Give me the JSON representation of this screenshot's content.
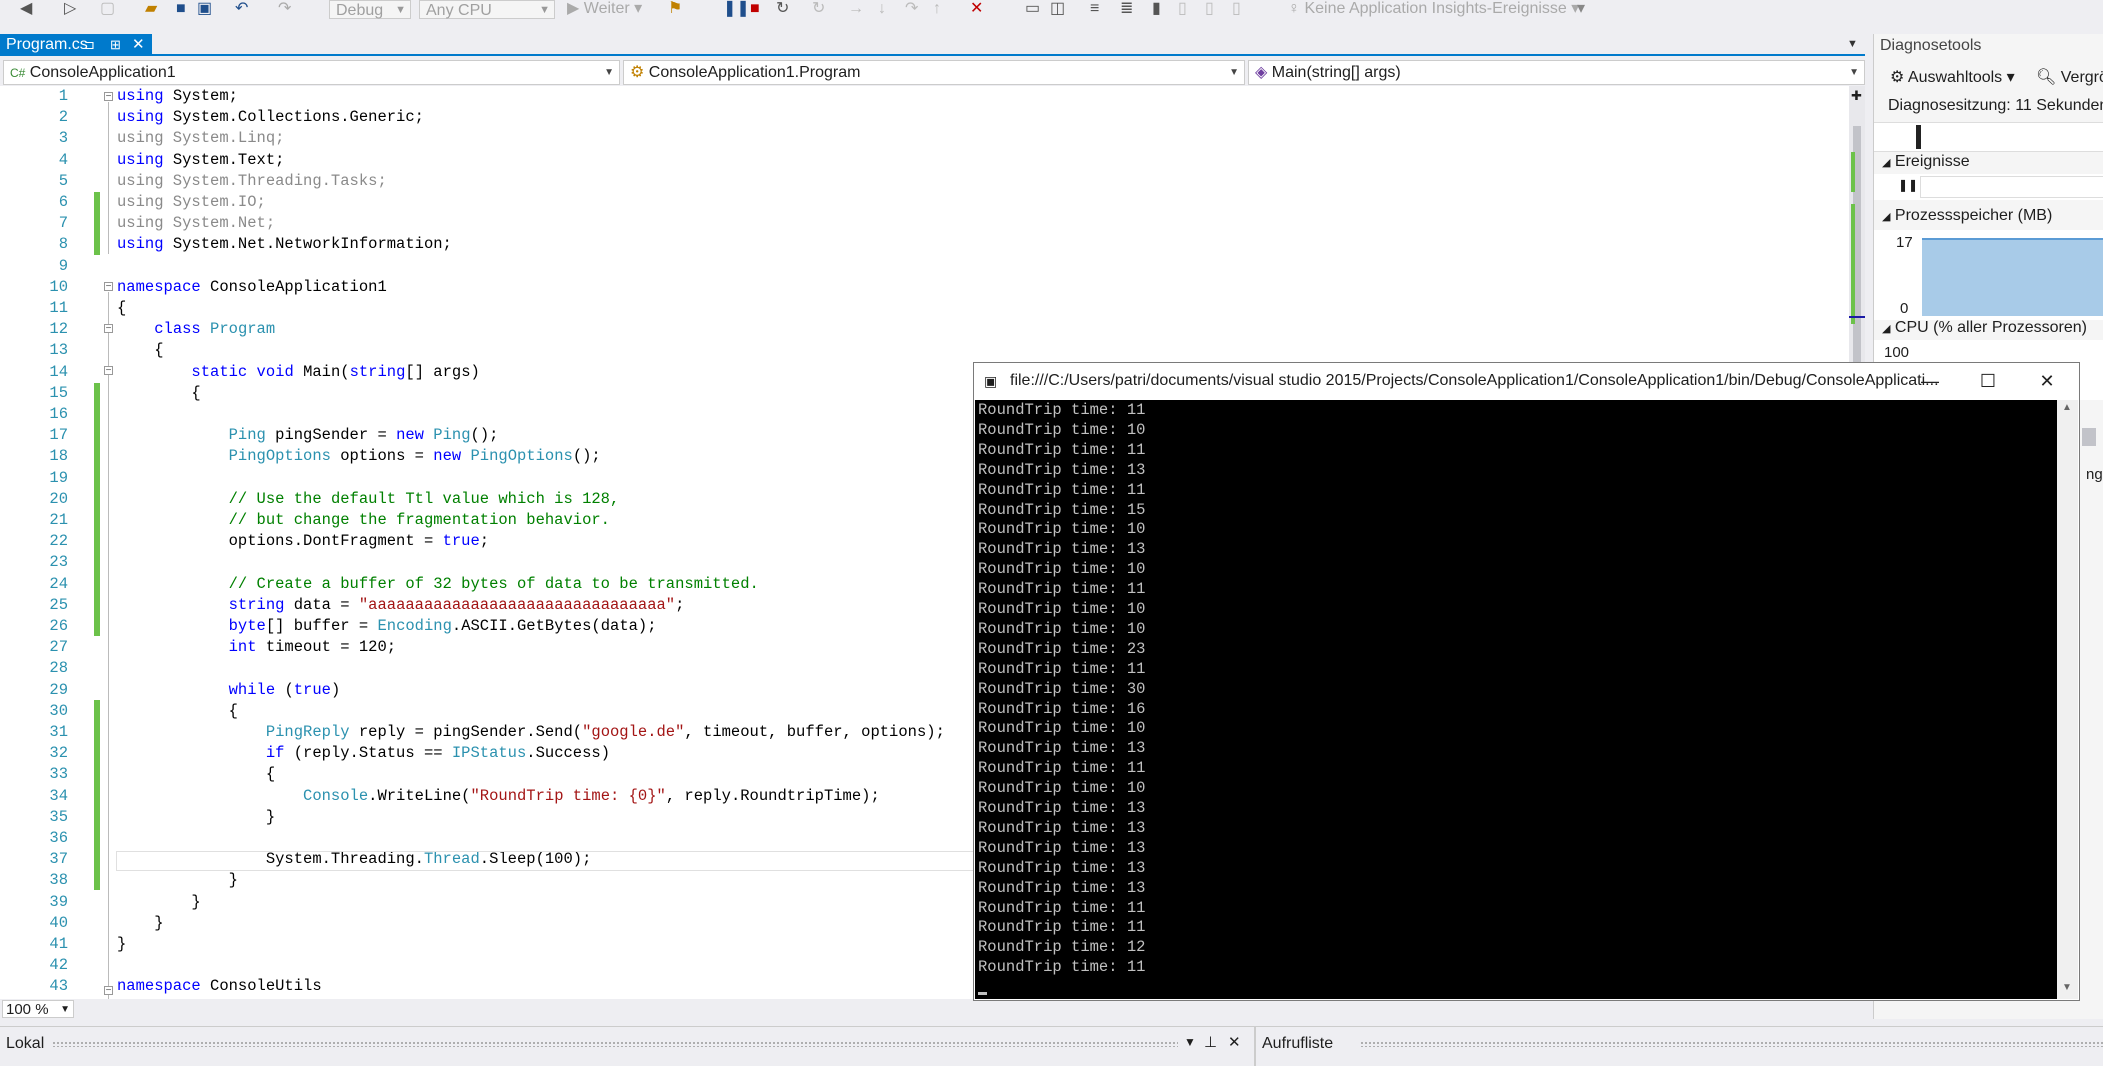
{
  "toolbar": {
    "config": "Debug",
    "platform": "Any CPU",
    "continue": "Weiter",
    "insights": "Keine Application Insights-Ereignisse"
  },
  "tabs": [
    {
      "label": "Program.cs",
      "active": true
    }
  ],
  "navbar": {
    "project": "ConsoleApplication1",
    "class": "ConsoleApplication1.Program",
    "member": "Main(string[] args)"
  },
  "editor": {
    "zoom": "100 %",
    "lines": [
      {
        "n": "1",
        "html": "<span class=\"kw\">using</span> System;"
      },
      {
        "n": "2",
        "html": "<span class=\"kw\">using</span> System.Collections.Generic;"
      },
      {
        "n": "3",
        "html": "<span class=\"dim\">using System.Linq;</span>"
      },
      {
        "n": "4",
        "html": "<span class=\"kw\">using</span> System.Text;"
      },
      {
        "n": "5",
        "html": "<span class=\"dim\">using System.Threading.Tasks;</span>"
      },
      {
        "n": "6",
        "html": "<span class=\"dim\">using System.IO;</span>"
      },
      {
        "n": "7",
        "html": "<span class=\"dim\">using System.Net;</span>"
      },
      {
        "n": "8",
        "html": "<span class=\"kw\">using</span> System.Net.NetworkInformation;"
      },
      {
        "n": "9",
        "html": ""
      },
      {
        "n": "10",
        "html": "<span class=\"kw\">namespace</span> ConsoleApplication1"
      },
      {
        "n": "11",
        "html": "{"
      },
      {
        "n": "12",
        "html": "    <span class=\"kw\">class</span> <span class=\"ty\">Program</span>"
      },
      {
        "n": "13",
        "html": "    {"
      },
      {
        "n": "14",
        "html": "        <span class=\"kw\">static</span> <span class=\"kw\">void</span> Main(<span class=\"kw\">string</span>[] args)"
      },
      {
        "n": "15",
        "html": "        {"
      },
      {
        "n": "16",
        "html": ""
      },
      {
        "n": "17",
        "html": "            <span class=\"ty\">Ping</span> pingSender = <span class=\"kw\">new</span> <span class=\"ty\">Ping</span>();"
      },
      {
        "n": "18",
        "html": "            <span class=\"ty\">PingOptions</span> options = <span class=\"kw\">new</span> <span class=\"ty\">PingOptions</span>();"
      },
      {
        "n": "19",
        "html": ""
      },
      {
        "n": "20",
        "html": "            <span class=\"cm\">// Use the default Ttl value which is 128,</span>"
      },
      {
        "n": "21",
        "html": "            <span class=\"cm\">// but change the fragmentation behavior.</span>"
      },
      {
        "n": "22",
        "html": "            options.DontFragment = <span class=\"kw\">true</span>;"
      },
      {
        "n": "23",
        "html": ""
      },
      {
        "n": "24",
        "html": "            <span class=\"cm\">// Create a buffer of 32 bytes of data to be transmitted.</span>"
      },
      {
        "n": "25",
        "html": "            <span class=\"kw\">string</span> data = <span class=\"str\">\"aaaaaaaaaaaaaaaaaaaaaaaaaaaaaaaa\"</span>;"
      },
      {
        "n": "26",
        "html": "            <span class=\"kw\">byte</span>[] buffer = <span class=\"ty\">Encoding</span>.ASCII.GetBytes(data);"
      },
      {
        "n": "27",
        "html": "            <span class=\"kw\">int</span> timeout = 120;"
      },
      {
        "n": "28",
        "html": ""
      },
      {
        "n": "29",
        "html": "            <span class=\"kw\">while</span> (<span class=\"kw\">true</span>)"
      },
      {
        "n": "30",
        "html": "            {"
      },
      {
        "n": "31",
        "html": "                <span class=\"ty\">PingReply</span> reply = pingSender.Send(<span class=\"str\">\"google.de\"</span>, timeout, buffer, options);"
      },
      {
        "n": "32",
        "html": "                <span class=\"kw\">if</span> (reply.Status == <span class=\"ty\">IPStatus</span>.Success)"
      },
      {
        "n": "33",
        "html": "                {"
      },
      {
        "n": "34",
        "html": "                    <span class=\"ty\">Console</span>.WriteLine(<span class=\"str\">\"RoundTrip time: {0}\"</span>, reply.RoundtripTime);"
      },
      {
        "n": "35",
        "html": "                }"
      },
      {
        "n": "36",
        "html": ""
      },
      {
        "n": "37",
        "html": "                System.Threading.<span class=\"ty\">Thread</span>.Sleep(100);"
      },
      {
        "n": "38",
        "html": "            }"
      },
      {
        "n": "39",
        "html": "        }"
      },
      {
        "n": "40",
        "html": "    }"
      },
      {
        "n": "41",
        "html": "}"
      },
      {
        "n": "42",
        "html": ""
      },
      {
        "n": "43",
        "html": "<span class=\"kw\">namespace</span> ConsoleUtils"
      }
    ]
  },
  "console": {
    "title": "file:///C:/Users/patri/documents/visual studio 2015/Projects/ConsoleApplication1/ConsoleApplication1/bin/Debug/ConsoleApplicati...",
    "lines": [
      "RoundTrip time: 11",
      "RoundTrip time: 10",
      "RoundTrip time: 11",
      "RoundTrip time: 13",
      "RoundTrip time: 11",
      "RoundTrip time: 15",
      "RoundTrip time: 10",
      "RoundTrip time: 13",
      "RoundTrip time: 10",
      "RoundTrip time: 11",
      "RoundTrip time: 10",
      "RoundTrip time: 10",
      "RoundTrip time: 23",
      "RoundTrip time: 11",
      "RoundTrip time: 30",
      "RoundTrip time: 16",
      "RoundTrip time: 10",
      "RoundTrip time: 13",
      "RoundTrip time: 11",
      "RoundTrip time: 10",
      "RoundTrip time: 13",
      "RoundTrip time: 13",
      "RoundTrip time: 13",
      "RoundTrip time: 13",
      "RoundTrip time: 13",
      "RoundTrip time: 11",
      "RoundTrip time: 11",
      "RoundTrip time: 12",
      "RoundTrip time: 11"
    ]
  },
  "diagnostics": {
    "title": "Diagnosetools",
    "select_tools": "Auswahltools",
    "zoom_partial": "Vergrö",
    "session": "Diagnosesitzung: 11 Sekunden",
    "events": "Ereignisse",
    "memory": "Prozessspeicher (MB)",
    "memory_max": "17",
    "memory_min": "0",
    "cpu": "CPU (% aller Prozessoren)",
    "cpu_max": "100",
    "partial_right": "ng"
  },
  "bottom": {
    "left_panel": "Lokal",
    "right_panel": "Aufrufliste"
  },
  "colors": {
    "accent": "#007acc",
    "change_bar": "#6cc24a",
    "keyword": "#0000ff",
    "type": "#2b91af",
    "string": "#a31515",
    "comment": "#008000"
  }
}
